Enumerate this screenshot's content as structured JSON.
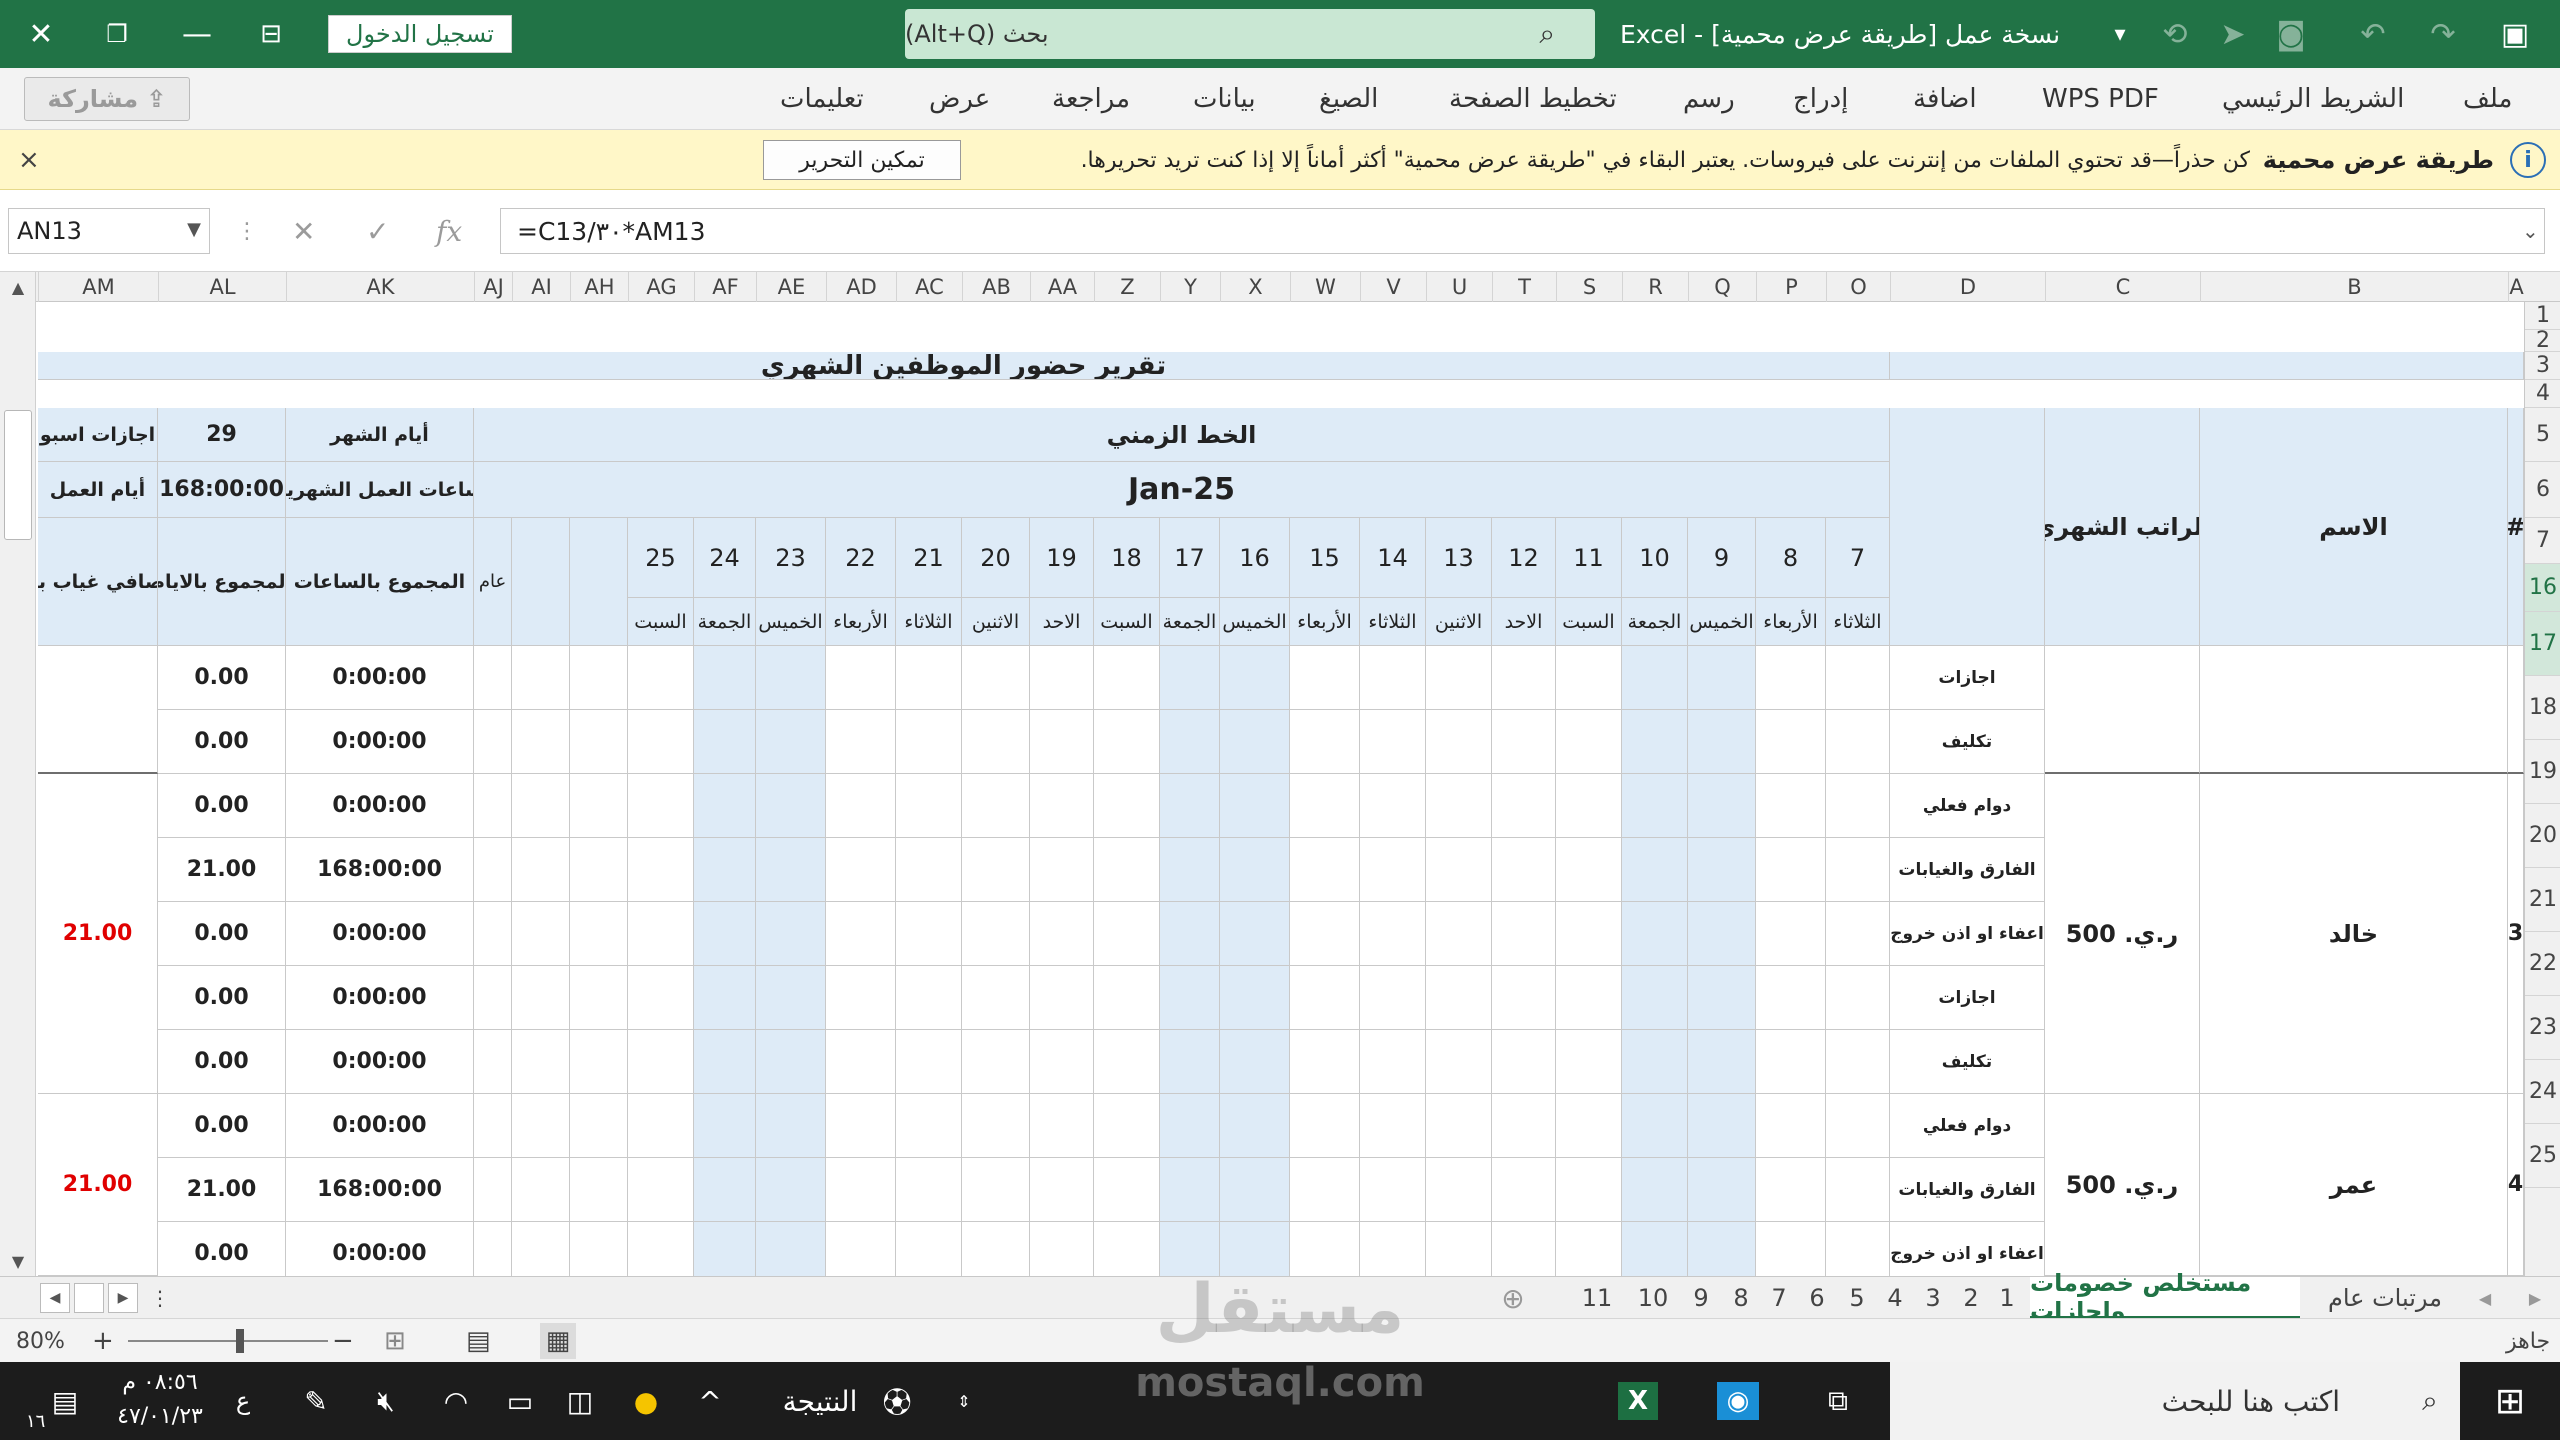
{
  "titlebar": {
    "signin": "تسجيل الدخول",
    "search_hint": "بحث (Alt+Q)",
    "doc_title": "Excel  -  نسخة عمل [طريقة عرض محمية]",
    "icons": [
      "close-icon",
      "restore-icon",
      "minimize-icon",
      "ribbon-display-icon",
      "search-icon",
      "customize-icon",
      "sync-icon",
      "send-icon",
      "camera-icon",
      "undo-icon",
      "redo-icon",
      "save-icon"
    ]
  },
  "ribbon": {
    "tabs": [
      "ملف",
      "الشريط الرئيسي",
      "WPS PDF",
      "اضافة",
      "إدراج",
      "رسم",
      "تخطيط الصفحة",
      "الصيغ",
      "بيانات",
      "مراجعة",
      "عرض",
      "تعليمات"
    ],
    "share": "مشاركة"
  },
  "protected": {
    "title": "طريقة عرض محمية",
    "message": "كن حذراً—قد تحتوي الملفات من إنترنت على فيروسات. يعتبر البقاء في \"طريقة عرض محمية\" أكثر أماناً إلا إذا كنت تريد تحريرها.",
    "enable": "تمكين التحرير",
    "close": "×"
  },
  "formula_bar": {
    "namebox": "AN13",
    "fx": "fx",
    "formula": "=C13/٣٠*AM13"
  },
  "columns": [
    "A",
    "B",
    "C",
    "D",
    "O",
    "P",
    "Q",
    "R",
    "S",
    "T",
    "U",
    "V",
    "W",
    "X",
    "Y",
    "Z",
    "AA",
    "AB",
    "AC",
    "AD",
    "AE",
    "AF",
    "AG",
    "AH",
    "AI",
    "AJ",
    "AK",
    "AL",
    "AM"
  ],
  "rows": [
    "1",
    "2",
    "3",
    "4",
    "5",
    "6",
    "7",
    "16",
    "17",
    "18",
    "19",
    "20",
    "21",
    "22",
    "23",
    "24",
    "25"
  ],
  "sheet": {
    "title": "تقرير حضور الموظفين الشهري",
    "timeline": "الخط الزمني",
    "month": "Jan-25",
    "col_hash": "#",
    "col_name": "الاسم",
    "col_salary": "الراتب الشهري",
    "days_label": "أيام الشهر",
    "days_value": "29",
    "weekly_off": "اجازات اسبو",
    "hours_label": "ساعات العمل الشهرية",
    "hours_value": "168:00:00",
    "work_days": "أيام العمل",
    "sum_hours": "المجموع بالساعات",
    "sum_days": "المجموع بالايام",
    "net_absence": "صافي غياب با",
    "general": "عام",
    "day_numbers": [
      "7",
      "8",
      "9",
      "10",
      "11",
      "12",
      "13",
      "14",
      "15",
      "16",
      "17",
      "18",
      "19",
      "20",
      "21",
      "22",
      "23",
      "24",
      "25"
    ],
    "day_names": [
      "الثلاثاء",
      "الأربعاء",
      "الخميس",
      "الجمعة",
      "السبت",
      "الاحد",
      "الاثنين",
      "الثلاثاء",
      "الأربعاء",
      "الخميس",
      "الجمعة",
      "السبت",
      "الاحد",
      "الاثنين",
      "الثلاثاء",
      "الأربعاء",
      "الخميس",
      "الجمعة",
      "السبت"
    ],
    "categories": [
      "دوام فعلي",
      "الفارق والغيابات",
      "اعفاء او اذن خروج",
      "اجازات",
      "تكليف"
    ],
    "employees": [
      {
        "num": "3",
        "name": "خالد",
        "salary": "ر.ي. 500",
        "net": "21.00"
      },
      {
        "num": "4",
        "name": "عمر",
        "salary": "ر.ي. 500",
        "net": "21.00"
      }
    ],
    "zero_time": "0:00:00",
    "zero": "0.00",
    "diff_time": "168:00:00",
    "diff_days": "21.00"
  },
  "tabs": {
    "sheets": [
      "مرتبات عام",
      "مستخلص خصومات واجازات",
      "1",
      "2",
      "3",
      "4",
      "5",
      "6",
      "7",
      "8",
      "9",
      "10",
      "11"
    ],
    "active": "مستخلص خصومات واجازات"
  },
  "status": {
    "ready": "جاهز",
    "zoom": "80%"
  },
  "taskbar": {
    "search": "اكتب هنا للبحث",
    "result": "النتيجة",
    "time": "٠٨:٥٦ م",
    "date": "٤٧/٠١/٢٣",
    "lang": "ع",
    "notif": "١٦"
  },
  "watermark": {
    "ar": "مستقل",
    "en": "mostaql.com"
  },
  "colors": {
    "excel_green": "#217346",
    "weekend_blue": "#deebf7",
    "alert_red": "#e00000",
    "protected_yellow": "#fff7c8"
  }
}
